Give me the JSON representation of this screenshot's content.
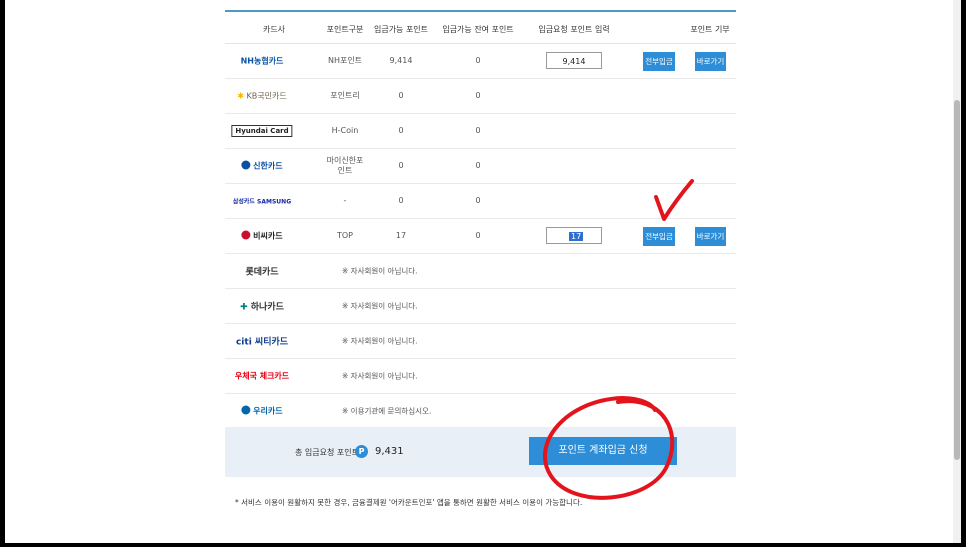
{
  "header": {
    "card_company": "카드사",
    "point_type": "포인트구분",
    "available": "입금가능 포인트",
    "remaining": "입금가능 잔여 포인트",
    "request_input": "입금요청 포인트 입력",
    "donate": "포인트 기부"
  },
  "rows": [
    {
      "company": "NH농협카드",
      "point_type": "NH포인트",
      "available": "9,414",
      "remaining": "0",
      "input": "9,414",
      "all_button": "전부입금",
      "go_button": "바로가기",
      "logo_color": "#0a56a4"
    },
    {
      "company": "KB국민카드",
      "point_type": "포인트리",
      "available": "0",
      "remaining": "0",
      "logo_color": "#6b5e48"
    },
    {
      "company": "Hyundai Card",
      "point_type": "H-Coin",
      "available": "0",
      "remaining": "0",
      "logo_color": "#222222"
    },
    {
      "company": "신한카드",
      "point_type": "마이신한포\n인트",
      "available": "0",
      "remaining": "0",
      "logo_color": "#0b4ea2"
    },
    {
      "company": "삼성카드 SAMSUNG",
      "point_type": "-",
      "available": "0",
      "remaining": "0",
      "logo_color": "#1428a0"
    },
    {
      "company": "비씨카드",
      "point_type": "TOP",
      "available": "17",
      "remaining": "0",
      "input": "17",
      "all_button": "전부입금",
      "go_button": "바로가기",
      "logo_color": "#c8102e"
    },
    {
      "company": "롯데카드",
      "note": "※ 자사회원이 아닙니다.",
      "logo_color": "#333333"
    },
    {
      "company": "하나카드",
      "note": "※ 자사회원이 아닙니다.",
      "logo_color": "#008485"
    },
    {
      "company": "citi 씨티카드",
      "note": "※ 자사회원이 아닙니다.",
      "logo_color": "#0f3c8c"
    },
    {
      "company": "우체국 체크카드",
      "note": "※ 자사회원이 아닙니다.",
      "logo_color": "#e60012"
    },
    {
      "company": "우리카드",
      "note": "※ 이용기관에 문의하십시오.",
      "logo_color": "#0067ac"
    }
  ],
  "footer": {
    "total_label": "총 입금요청 포인트",
    "badge": "P",
    "total_value": "9,431",
    "apply_button": "포인트 계좌입금 신청"
  },
  "disclaimer": "* 서비스 이용이 원활하지 못한 경우, 금융결제원 '어카운트인포' 앱을 통하면 원활한 서비스 이용이 가능합니다.",
  "colors": {
    "accent": "#2d8dd6",
    "annotation": "#e3141c",
    "footer_bg": "#e9eff6"
  }
}
